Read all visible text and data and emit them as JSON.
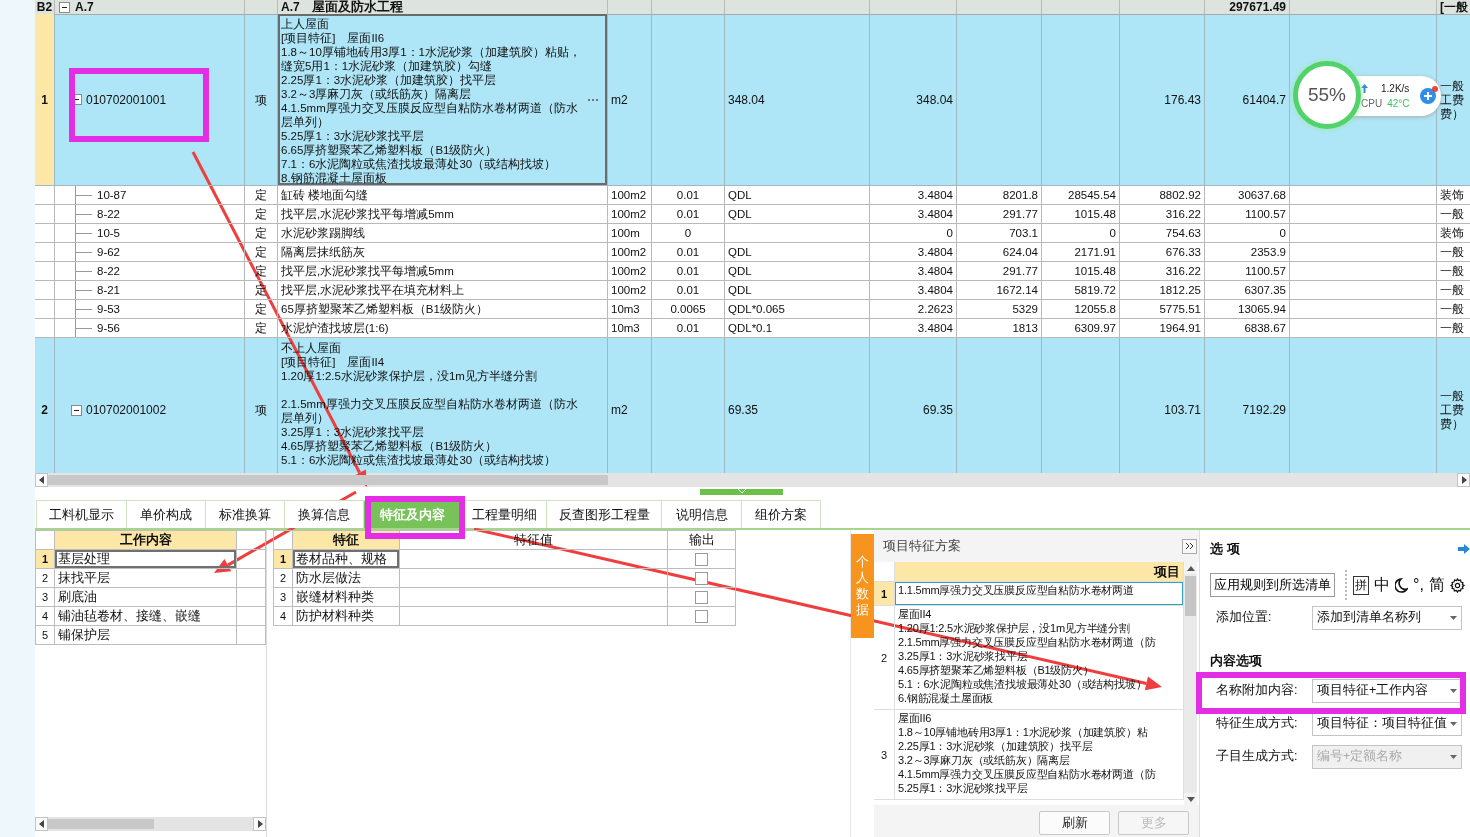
{
  "main_table": {
    "header_row": {
      "row_label": "B2",
      "code": "A.7",
      "expanded": true,
      "name_code": "A.7",
      "name": "屋面及防水工程",
      "cells": {
        "column_12": "297671.49",
        "column_14": "[一般"
      }
    },
    "rows": [
      {
        "kind": "item",
        "index": "1",
        "selected": true,
        "expanded": true,
        "editing": true,
        "code": "010702001001",
        "type": "项",
        "name": [
          "上人屋面",
          "[项目特征]　屋面II6",
          "1.8～10厚铺地砖用3厚1：1水泥砂浆（加建筑胶）粘贴，缝宽5用1：1水泥砂浆（加建筑胶）勾缝",
          "2.25厚1：3水泥砂浆（加建筑胶）找平层",
          "3.2～3厚麻刀灰（或纸筋灰）隔离层",
          "4.1.5mm厚强力交叉压膜反应型自粘防水卷材两道（防水层单列）",
          "5.25厚1：3水泥砂浆找平层",
          "6.65厚挤塑聚苯乙烯塑料板（B1级防火）",
          "7.1：6水泥陶粒或焦渣找坡最薄处30（或结构找坡）",
          "8.钢筋混凝土屋面板"
        ],
        "cells": {
          "column_5": "m2",
          "column_7": "348.04",
          "column_8": "348.04",
          "column_11": "176.43",
          "column_12": "61404.7",
          "column_14": "一般工费费）"
        }
      },
      {
        "kind": "sub",
        "code": "10-87",
        "type": "定",
        "name": [
          "缸砖 楼地面勾缝"
        ],
        "cells": {
          "column_5": "100m2",
          "column_6": "0.01",
          "column_7": "QDL",
          "column_8": "3.4804",
          "column_9": "8201.8",
          "column_10": "28545.54",
          "column_11": "8802.92",
          "column_12": "30637.68",
          "column_14": "装饰"
        }
      },
      {
        "kind": "sub",
        "code": "8-22",
        "type": "定",
        "name": [
          "找平层,水泥砂浆找平每增减5mm"
        ],
        "cells": {
          "column_5": "100m2",
          "column_6": "0.01",
          "column_7": "QDL",
          "column_8": "3.4804",
          "column_9": "291.77",
          "column_10": "1015.48",
          "column_11": "316.22",
          "column_12": "1100.57",
          "column_14": "一般"
        }
      },
      {
        "kind": "sub",
        "code": "10-5",
        "type": "定",
        "name": [
          "水泥砂浆踢脚线"
        ],
        "cells": {
          "column_5": "100m",
          "column_6": "0",
          "column_8": "0",
          "column_9": "703.1",
          "column_10": "0",
          "column_11": "754.63",
          "column_12": "0",
          "column_14": "装饰"
        }
      },
      {
        "kind": "sub",
        "code": "9-62",
        "type": "定",
        "name": [
          "隔离层抹纸筋灰"
        ],
        "cells": {
          "column_5": "100m2",
          "column_6": "0.01",
          "column_7": "QDL",
          "column_8": "3.4804",
          "column_9": "624.04",
          "column_10": "2171.91",
          "column_11": "676.33",
          "column_12": "2353.9",
          "column_14": "一般"
        }
      },
      {
        "kind": "sub",
        "code": "8-22",
        "type": "定",
        "name": [
          "找平层,水泥砂浆找平每增减5mm"
        ],
        "cells": {
          "column_5": "100m2",
          "column_6": "0.01",
          "column_7": "QDL",
          "column_8": "3.4804",
          "column_9": "291.77",
          "column_10": "1015.48",
          "column_11": "316.22",
          "column_12": "1100.57",
          "column_14": "一般"
        }
      },
      {
        "kind": "sub",
        "code": "8-21",
        "type": "定",
        "name": [
          "找平层,水泥砂浆找平在填充材料上"
        ],
        "cells": {
          "column_5": "100m2",
          "column_6": "0.01",
          "column_7": "QDL",
          "column_8": "3.4804",
          "column_9": "1672.14",
          "column_10": "5819.72",
          "column_11": "1812.25",
          "column_12": "6307.35",
          "column_14": "一般"
        }
      },
      {
        "kind": "sub",
        "code": "9-53",
        "type": "定",
        "name": [
          "65厚挤塑聚苯乙烯塑料板（B1级防火）"
        ],
        "cells": {
          "column_5": "10m3",
          "column_6": "0.0065",
          "column_7": "QDL*0.065",
          "column_8": "2.2623",
          "column_9": "5329",
          "column_10": "12055.8",
          "column_11": "5775.51",
          "column_12": "13065.94",
          "column_14": "一般"
        }
      },
      {
        "kind": "sub",
        "code": "9-56",
        "type": "定",
        "name": [
          "水泥炉渣找坡层(1:6)"
        ],
        "cells": {
          "column_5": "10m3",
          "column_6": "0.01",
          "column_7": "QDL*0.1",
          "column_8": "3.4804",
          "column_9": "1813",
          "column_10": "6309.97",
          "column_11": "1964.91",
          "column_12": "6838.67",
          "column_14": "一般"
        }
      },
      {
        "kind": "item",
        "index": "2",
        "selected": false,
        "expanded": true,
        "editing": false,
        "code": "010702001002",
        "type": "项",
        "name": [
          "不上人屋面",
          "[项目特征]　屋面II4",
          "1.20厚1:2.5水泥砂浆保护层，没1m见方半缝分割",
          {
            "text": "2.1.5mm厚强力交叉压膜反应型自粘防水卷材两道（防水层单列）",
            "space_before": true
          },
          "3.25厚1：3水泥砂浆找平层",
          "4.65厚挤塑聚苯乙烯塑料板（B1级防火）",
          "5.1：6水泥陶粒或焦渣找坡最薄处30（或结构找坡）"
        ],
        "cells": {
          "column_5": "m2",
          "column_7": "69.35",
          "column_8": "69.35",
          "column_11": "103.71",
          "column_12": "7192.29",
          "column_14": "一般工费费）"
        }
      }
    ]
  },
  "tabs": [
    {
      "label": "工料机显示",
      "selected": false
    },
    {
      "label": "单价构成",
      "selected": false
    },
    {
      "label": "标准换算",
      "selected": false
    },
    {
      "label": "换算信息",
      "selected": false
    },
    {
      "label": "特征及内容",
      "selected": true
    },
    {
      "label": "工程量明细",
      "selected": false
    },
    {
      "label": "反查图形工程量",
      "selected": false
    },
    {
      "label": "说明信息",
      "selected": false
    },
    {
      "label": "组价方案",
      "selected": false
    }
  ],
  "work_content": {
    "column": "工作内容",
    "rows": [
      {
        "index": "1",
        "text": "基层处理",
        "selected": true
      },
      {
        "index": "2",
        "text": "抹找平层",
        "selected": false
      },
      {
        "index": "3",
        "text": "刷底油",
        "selected": false
      },
      {
        "index": "4",
        "text": "铺油毡卷材、接缝、嵌缝",
        "selected": false
      },
      {
        "index": "5",
        "text": "铺保护层",
        "selected": false
      }
    ]
  },
  "features": {
    "columns": [
      "特征",
      "特征值",
      "输出"
    ],
    "rows": [
      {
        "index": "1",
        "feature": "卷材品种、规格",
        "selected": true,
        "output": false
      },
      {
        "index": "2",
        "feature": "防水层做法",
        "selected": false,
        "output": false
      },
      {
        "index": "3",
        "feature": "嵌缝材料种类",
        "selected": false,
        "output": false
      },
      {
        "index": "4",
        "feature": "防护材料种类",
        "selected": false,
        "output": false
      }
    ]
  },
  "side_tab": {
    "label": "个人数据"
  },
  "scheme_panel": {
    "title": "项目特征方案",
    "column": "项目",
    "rows": [
      {
        "index": "1",
        "lines": [
          "1.1.5mm厚强力交叉压膜反应型自粘防水卷材两道"
        ],
        "selected": true
      },
      {
        "index": "2",
        "lines": [
          "屋面II4",
          "1.20厚1:2.5水泥砂浆保护层，没1m见方半缝分割",
          "2.1.5mm厚强力交叉压膜反应型自粘防水卷材两道（防",
          "3.25厚1：3水泥砂浆找平层",
          "4.65厚挤塑聚苯乙烯塑料板（B1级防火）",
          "5.1：6水泥陶粒或焦渣找坡最薄处30（或结构找坡）",
          "6.钢筋混凝土屋面板"
        ],
        "selected": false
      },
      {
        "index": "3",
        "lines": [
          "屋面II6",
          "1.8～10厚铺地砖用3厚1：1水泥砂浆（加建筑胶）粘",
          "2.25厚1：3水泥砂浆（加建筑胶）找平层",
          "3.2～3厚麻刀灰（或纸筋灰）隔离层",
          "4.1.5mm厚强力交叉压膜反应型自粘防水卷材两道（防",
          "5.25厚1：3水泥砂浆找平层"
        ],
        "selected": false
      }
    ],
    "buttons": [
      {
        "label": "刷新",
        "disabled": false
      },
      {
        "label": "更多",
        "disabled": true
      }
    ]
  },
  "options": {
    "title": "选 项",
    "apply_button": "应用规则到所选清单",
    "ime_toolbar": [
      {
        "kind": "boxed",
        "text": "拼"
      },
      {
        "kind": "text",
        "text": "中"
      },
      {
        "kind": "moon"
      },
      {
        "kind": "text",
        "text": "°,"
      },
      {
        "kind": "text",
        "text": "简"
      },
      {
        "kind": "gear"
      }
    ],
    "fields": [
      {
        "kind": "field",
        "label": "添加位置:",
        "value": "添加到清单名称列",
        "disabled": false
      },
      {
        "kind": "heading",
        "label": "内容选项"
      },
      {
        "kind": "field",
        "label": "名称附加内容:",
        "value": "项目特征+工作内容",
        "disabled": false
      },
      {
        "kind": "field",
        "label": "特征生成方式:",
        "value": "项目特征：项目特征值",
        "disabled": false
      },
      {
        "kind": "field",
        "label": "子目生成方式:",
        "value": "编号+定额名称",
        "disabled": true
      }
    ]
  },
  "system_monitor": {
    "load": "55%",
    "upload_rate": "1.2K/s",
    "cpu_label": "CPU",
    "cpu_temp": "42°C"
  }
}
